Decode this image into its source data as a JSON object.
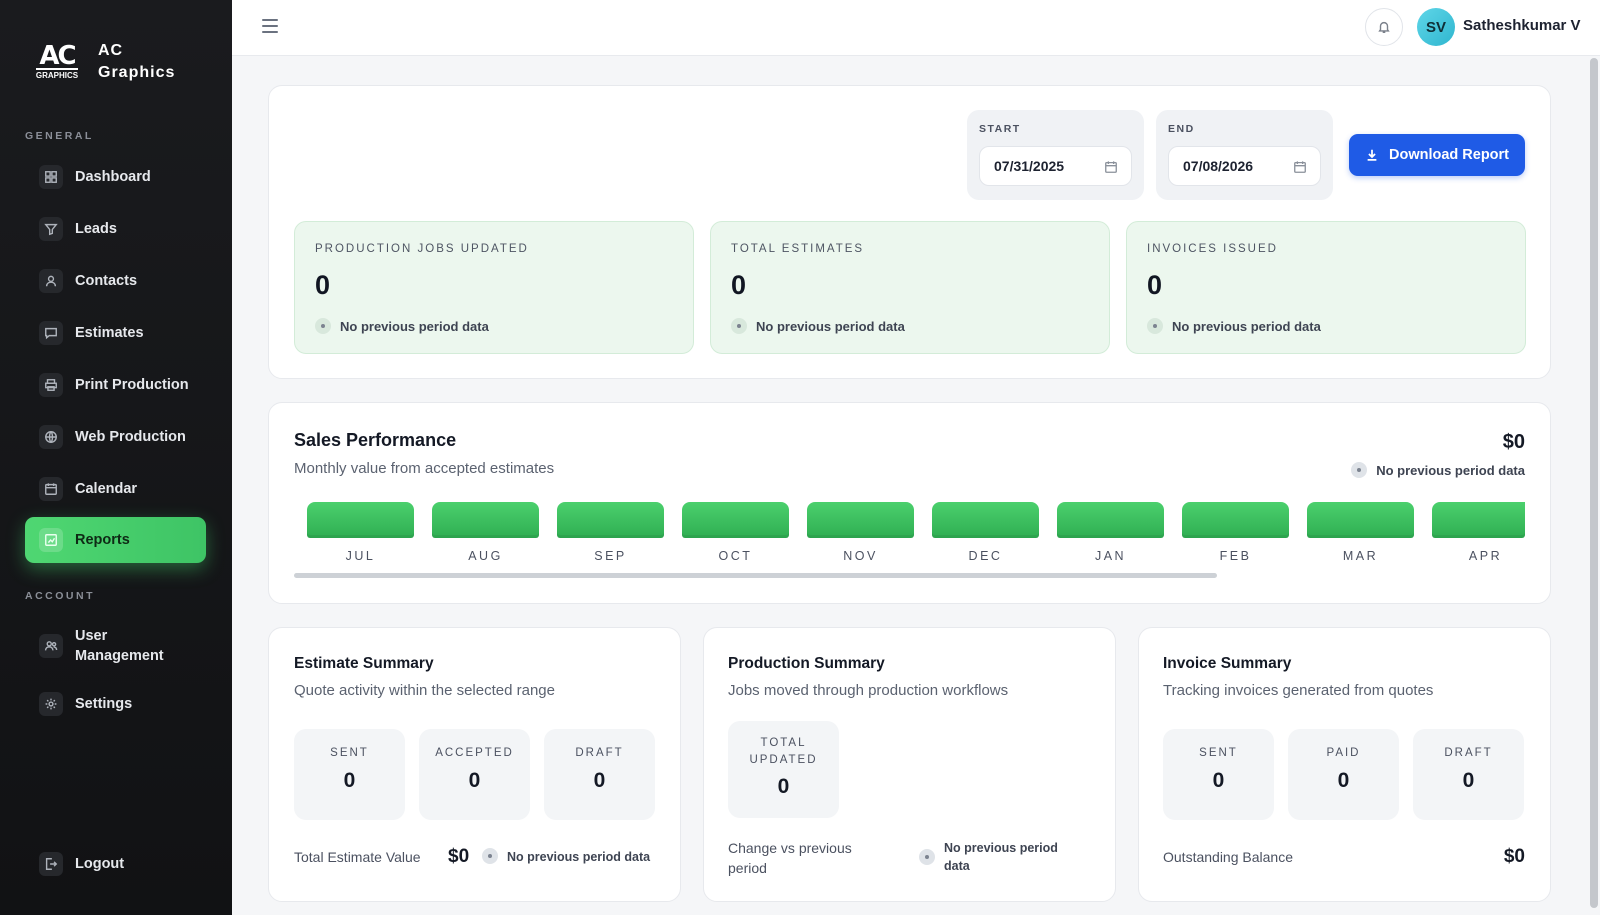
{
  "brand": {
    "logo_big": "AC",
    "logo_small": "GRAPHICS",
    "line1": "AC",
    "line2": "Graphics"
  },
  "sidebar": {
    "general_label": "GENERAL",
    "account_label": "ACCOUNT",
    "items": [
      {
        "label": "Dashboard"
      },
      {
        "label": "Leads"
      },
      {
        "label": "Contacts"
      },
      {
        "label": "Estimates"
      },
      {
        "label": "Print Production"
      },
      {
        "label": "Web Production"
      },
      {
        "label": "Calendar"
      },
      {
        "label": "Reports"
      }
    ],
    "account_items": [
      {
        "label_line1": "User",
        "label_line2": "Management"
      },
      {
        "label": "Settings"
      }
    ],
    "logout": "Logout"
  },
  "topbar": {
    "avatar_initials": "SV",
    "username": "Satheshkumar V"
  },
  "filters": {
    "start_label": "START",
    "start_value": "07/31/2025",
    "end_label": "END",
    "end_value": "07/08/2026",
    "download_label": "Download Report"
  },
  "metrics": [
    {
      "title": "PRODUCTION JOBS UPDATED",
      "value": "0",
      "note": "No previous period data"
    },
    {
      "title": "TOTAL ESTIMATES",
      "value": "0",
      "note": "No previous period data"
    },
    {
      "title": "INVOICES ISSUED",
      "value": "0",
      "note": "No previous period data"
    }
  ],
  "sales": {
    "title": "Sales Performance",
    "subtitle": "Monthly value from accepted estimates",
    "total": "$0",
    "note": "No previous period data"
  },
  "chart_data": {
    "type": "bar",
    "categories": [
      "JUL",
      "AUG",
      "SEP",
      "OCT",
      "NOV",
      "DEC",
      "JAN",
      "FEB",
      "MAR",
      "APR"
    ],
    "values": [
      0,
      0,
      0,
      0,
      0,
      0,
      0,
      0,
      0,
      0
    ],
    "title": "Sales Performance"
  },
  "estimate_summary": {
    "title": "Estimate Summary",
    "subtitle": "Quote activity within the selected range",
    "stats": [
      {
        "label": "SENT",
        "value": "0"
      },
      {
        "label": "ACCEPTED",
        "value": "0"
      },
      {
        "label": "DRAFT",
        "value": "0"
      }
    ],
    "footer_label": "Total Estimate Value",
    "footer_value": "$0",
    "footer_note": "No previous period data"
  },
  "production_summary": {
    "title": "Production Summary",
    "subtitle": "Jobs moved through production workflows",
    "stat_label_line1": "TOTAL",
    "stat_label_line2": "UPDATED",
    "stat_value": "0",
    "footer_label_line1": "Change vs previous",
    "footer_label_line2": "period",
    "footer_note_line1": "No previous period",
    "footer_note_line2": "data"
  },
  "invoice_summary": {
    "title": "Invoice Summary",
    "subtitle": "Tracking invoices generated from quotes",
    "stats": [
      {
        "label": "SENT",
        "value": "0"
      },
      {
        "label": "PAID",
        "value": "0"
      },
      {
        "label": "DRAFT",
        "value": "0"
      }
    ],
    "footer_label": "Outstanding Balance",
    "footer_value": "$0"
  },
  "colors": {
    "accent_green": "#3ec465",
    "primary_blue": "#1f5be6",
    "sidebar_bg": "#151618"
  }
}
